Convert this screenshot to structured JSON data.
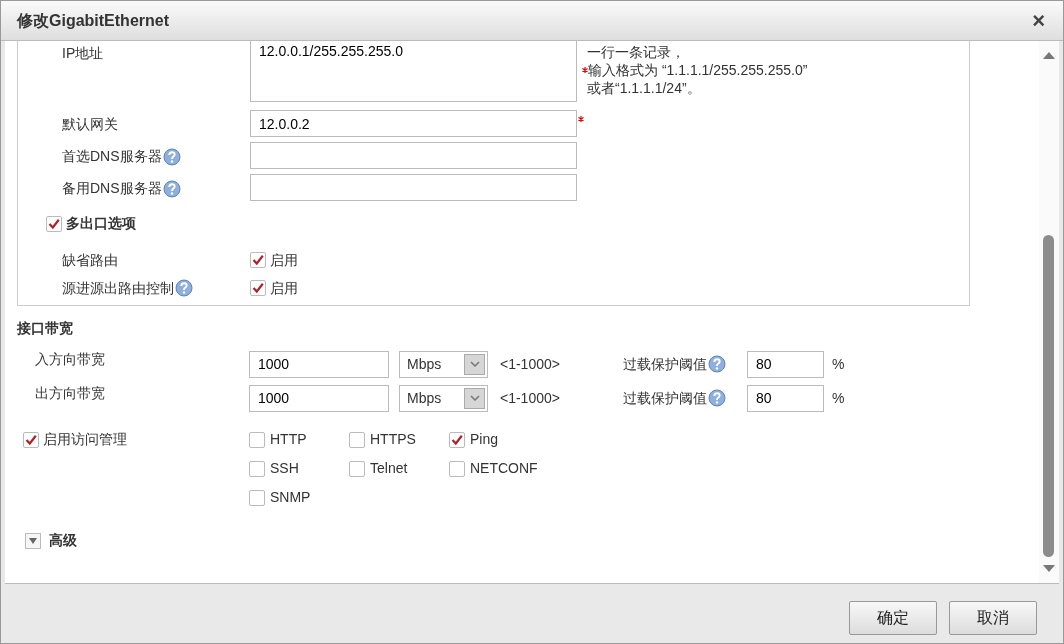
{
  "dialog": {
    "title": "修改GigabitEthernet",
    "close": "×"
  },
  "address_fields": [
    {
      "kind": "textarea",
      "label": "IP地址",
      "value": "12.0.0.1/255.255.255.0",
      "help": false,
      "required": false,
      "hint": [
        {
          "text": "一行一条记录，",
          "required": false
        },
        {
          "text": "输入格式为 “1.1.1.1/255.255.255.0”",
          "required": true
        },
        {
          "text": "或者“1.1.1.1/24”。",
          "required": false
        }
      ]
    },
    {
      "kind": "input",
      "label": "默认网关",
      "value": "12.0.0.2",
      "help": false,
      "required": true
    },
    {
      "kind": "input",
      "label": "首选DNS服务器",
      "help": true,
      "required": false
    },
    {
      "kind": "input",
      "label": "备用DNS服务器",
      "help": true,
      "required": false
    }
  ],
  "multi_exit": {
    "label": "多出口选项",
    "checked": true,
    "options": [
      {
        "label": "缺省路由",
        "help": false,
        "checked": true,
        "text": "启用"
      },
      {
        "label": "源进源出路由控制",
        "help": true,
        "checked": true,
        "text": "启用"
      }
    ]
  },
  "bandwidth": {
    "title": "接口带宽",
    "rows": [
      {
        "label": "入方向带宽",
        "value": "1000",
        "unit": "Mbps",
        "range": "<1-1000>",
        "threshold_label": "过载保护阈值",
        "threshold": "80",
        "percent": "%"
      },
      {
        "label": "出方向带宽",
        "value": "1000",
        "unit": "Mbps",
        "range": "<1-1000>",
        "threshold_label": "过载保护阈值",
        "threshold": "80",
        "percent": "%"
      }
    ]
  },
  "access": {
    "label": "启用访问管理",
    "checked": true,
    "protocols": [
      {
        "label": "HTTP",
        "checked": false
      },
      {
        "label": "HTTPS",
        "checked": false
      },
      {
        "label": "Ping",
        "checked": true
      },
      {
        "label": "SSH",
        "checked": false
      },
      {
        "label": "Telnet",
        "checked": false
      },
      {
        "label": "NETCONF",
        "checked": false
      },
      {
        "label": "SNMP",
        "checked": false
      }
    ]
  },
  "advanced": {
    "label": "高级",
    "expanded": false
  },
  "buttons": [
    {
      "label": "确定"
    },
    {
      "label": "取消"
    }
  ]
}
